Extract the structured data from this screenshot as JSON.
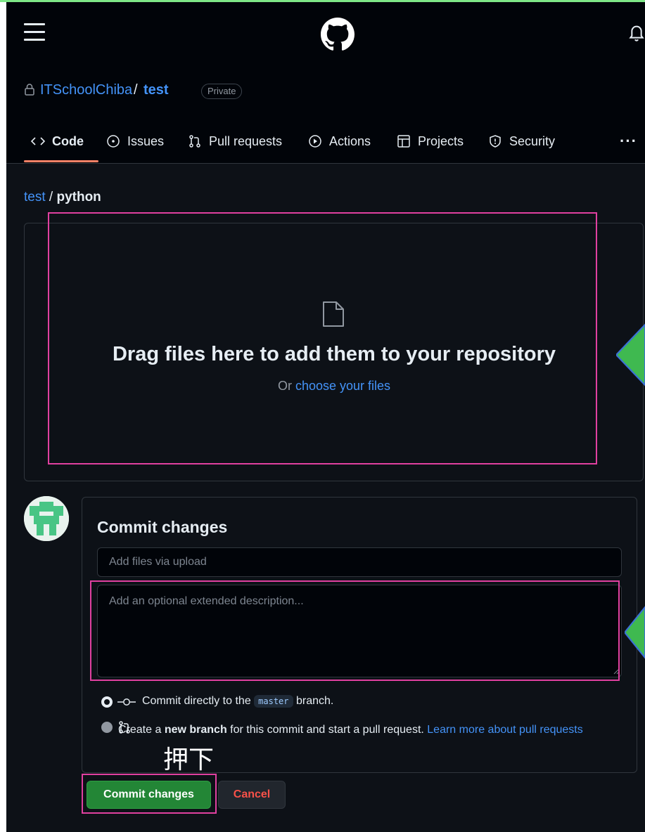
{
  "header": {
    "menu_icon": "hamburger-icon",
    "logo_icon": "github-logo-icon",
    "notification_icon": "bell-icon"
  },
  "repo": {
    "owner": "ITSchoolChiba",
    "separator": "/",
    "name": "test",
    "visibility": "Private"
  },
  "tabs": [
    {
      "label": "Code",
      "icon": "code-icon",
      "active": true
    },
    {
      "label": "Issues",
      "icon": "issue-opened-icon"
    },
    {
      "label": "Pull requests",
      "icon": "git-pull-request-icon"
    },
    {
      "label": "Actions",
      "icon": "play-icon"
    },
    {
      "label": "Projects",
      "icon": "table-icon"
    },
    {
      "label": "Security",
      "icon": "shield-icon"
    }
  ],
  "more_label": "···",
  "breadcrumb": {
    "repo": "test",
    "separator": " / ",
    "folder": "python"
  },
  "dropzone": {
    "icon": "file-icon",
    "title": "Drag files here to add them to your repository",
    "sub_prefix": "Or ",
    "sub_link": "choose your files"
  },
  "commit": {
    "title": "Commit changes",
    "summary_placeholder": "Add files via upload",
    "description_placeholder": "Add an optional extended description...",
    "option1": {
      "prefix": "Commit directly to the ",
      "branch": "master",
      "suffix": " branch.",
      "selected": true
    },
    "option2": {
      "prefix": "Create a ",
      "bold": "new branch",
      "middle": " for this commit and start a pull request. ",
      "link": "Learn more about pull requests",
      "selected": false
    },
    "commit_button": "Commit changes",
    "cancel_button": "Cancel"
  },
  "annotation": {
    "text": "押下",
    "highlight_color": "#e040a0",
    "arrow_color": "#3fb950"
  },
  "colors": {
    "accent_link": "#4493f8",
    "primary_button": "#238636",
    "danger_text": "#f85149",
    "tab_underline": "#f78166"
  }
}
